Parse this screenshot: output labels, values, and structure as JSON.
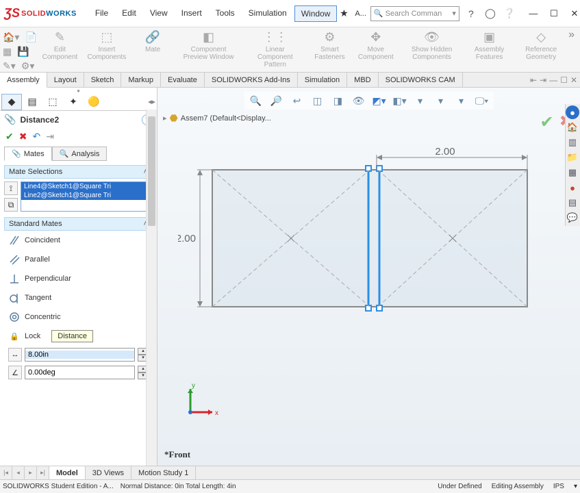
{
  "app": {
    "brandSolid": "SOLID",
    "brandWorks": "WORKS"
  },
  "menu": [
    "File",
    "Edit",
    "View",
    "Insert",
    "Tools",
    "Simulation",
    "Window"
  ],
  "menuActive": "Window",
  "titleRight": {
    "appLabel": "A...",
    "searchPlaceholder": "Search Comman"
  },
  "ribbon": [
    {
      "label": "Edit Component"
    },
    {
      "label": "Insert Components"
    },
    {
      "label": "Mate"
    },
    {
      "label": "Component Preview Window"
    },
    {
      "label": "Linear Component Pattern"
    },
    {
      "label": "Smart Fasteners"
    },
    {
      "label": "Move Component"
    },
    {
      "label": "Show Hidden Components"
    },
    {
      "label": "Assembly Features"
    },
    {
      "label": "Reference Geometry"
    }
  ],
  "tabs": [
    "Assembly",
    "Layout",
    "Sketch",
    "Markup",
    "Evaluate",
    "SOLIDWORKS Add-Ins",
    "Simulation",
    "MBD",
    "SOLIDWORKS CAM"
  ],
  "activeTab": "Assembly",
  "property": {
    "name": "Distance2",
    "modeTabs": {
      "mates": "Mates",
      "analysis": "Analysis"
    },
    "section1": "Mate Selections",
    "selections": [
      "Line4@Sketch1@Square Tri",
      "Line2@Sketch1@Square Tri"
    ],
    "section2": "Standard Mates",
    "mates": {
      "coincident": "Coincident",
      "parallel": "Parallel",
      "perpendicular": "Perpendicular",
      "tangent": "Tangent",
      "concentric": "Concentric",
      "lock": "Lock",
      "distanceTooltip": "Distance"
    },
    "distance": "8.00in",
    "angle": "0.00deg"
  },
  "viewport": {
    "breadcrumb": "Assem7  (Default<Display...",
    "dimTop": "2.00",
    "dimLeft": "2.00",
    "viewName": "*Front",
    "axisX": "x",
    "axisY": "y"
  },
  "bottomTabs": [
    "Model",
    "3D Views",
    "Motion Study 1"
  ],
  "status": {
    "edition": "SOLIDWORKS Student Edition - A...",
    "dist": "Normal Distance: 0in Total Length: 4in",
    "def": "Under Defined",
    "mode": "Editing Assembly",
    "units": "IPS"
  }
}
